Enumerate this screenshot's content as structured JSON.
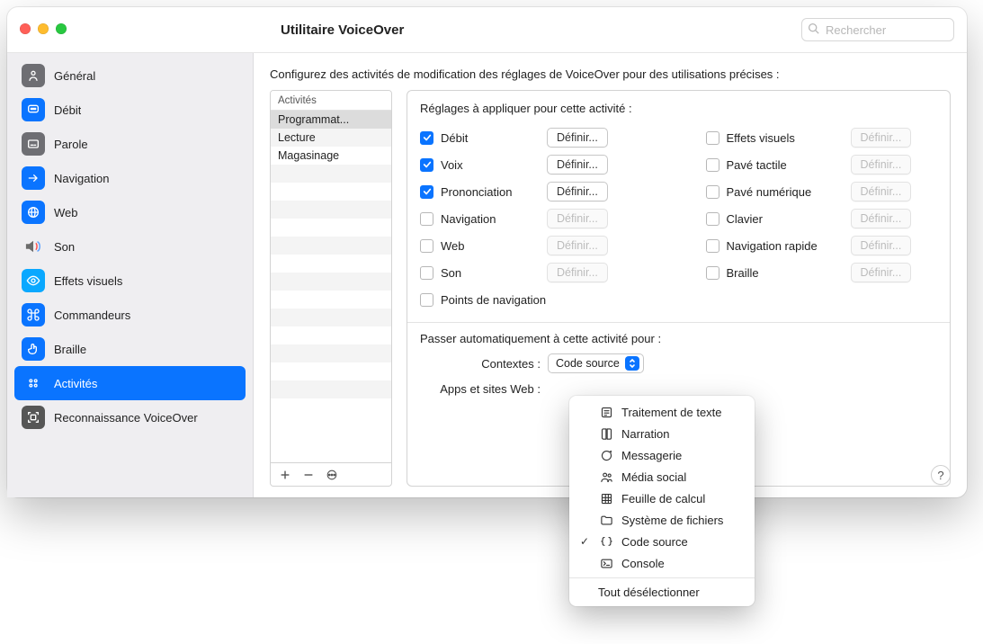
{
  "window": {
    "title": "Utilitaire VoiceOver",
    "search_placeholder": "Rechercher"
  },
  "sidebar": {
    "items": [
      {
        "label": "Général",
        "icon_name": "accessibility-icon",
        "icon_bg": "#6e6e73",
        "icon_glyph": "person"
      },
      {
        "label": "Débit",
        "icon_name": "speech-bubble-icon",
        "icon_bg": "#0a74ff",
        "icon_glyph": "bubble-dots"
      },
      {
        "label": "Parole",
        "icon_name": "caption-icon",
        "icon_bg": "#6e6e73",
        "icon_glyph": "caption"
      },
      {
        "label": "Navigation",
        "icon_name": "arrow-icon",
        "icon_bg": "#0a74ff",
        "icon_glyph": "arrow-right"
      },
      {
        "label": "Web",
        "icon_name": "globe-icon",
        "icon_bg": "#0a74ff",
        "icon_glyph": "globe"
      },
      {
        "label": "Son",
        "icon_name": "speaker-icon",
        "icon_bg": "transparent",
        "icon_glyph": "speaker"
      },
      {
        "label": "Effets visuels",
        "icon_name": "eye-icon",
        "icon_bg": "#0aa8ff",
        "icon_glyph": "eye"
      },
      {
        "label": "Commandeurs",
        "icon_name": "command-icon",
        "icon_bg": "#0a74ff",
        "icon_glyph": "command"
      },
      {
        "label": "Braille",
        "icon_name": "touch-icon",
        "icon_bg": "#0a74ff",
        "icon_glyph": "touch"
      },
      {
        "label": "Activités",
        "icon_name": "activities-icon",
        "icon_bg": "#0a74ff",
        "icon_glyph": "knobs",
        "selected": true
      },
      {
        "label": "Reconnaissance VoiceOver",
        "icon_name": "recognition-icon",
        "icon_bg": "#565656",
        "icon_glyph": "scan"
      }
    ]
  },
  "main": {
    "intro": "Configurez des activités de modification des réglages de VoiceOver pour des utilisations précises :",
    "activities_header": "Activités",
    "activities": [
      {
        "label": "Programmat...",
        "selected": true
      },
      {
        "label": "Lecture"
      },
      {
        "label": "Magasinage"
      }
    ],
    "footer": {
      "add_tooltip": "Ajouter",
      "remove_tooltip": "Supprimer",
      "more_tooltip": "Options"
    },
    "settings_title": "Réglages à appliquer pour cette activité :",
    "define_label": "Définir...",
    "left_options": [
      {
        "label": "Débit",
        "checked": true,
        "has_button": true
      },
      {
        "label": "Voix",
        "checked": true,
        "has_button": true
      },
      {
        "label": "Prononciation",
        "checked": true,
        "has_button": true
      },
      {
        "label": "Navigation",
        "checked": false,
        "has_button": true
      },
      {
        "label": "Web",
        "checked": false,
        "has_button": true
      },
      {
        "label": "Son",
        "checked": false,
        "has_button": true
      },
      {
        "label": "Points de navigation",
        "checked": false,
        "has_button": false
      }
    ],
    "right_options": [
      {
        "label": "Effets visuels",
        "checked": false,
        "has_button": true
      },
      {
        "label": "Pavé tactile",
        "checked": false,
        "has_button": true
      },
      {
        "label": "Pavé numérique",
        "checked": false,
        "has_button": true
      },
      {
        "label": "Clavier",
        "checked": false,
        "has_button": true
      },
      {
        "label": "Navigation rapide",
        "checked": false,
        "has_button": true
      },
      {
        "label": "Braille",
        "checked": false,
        "has_button": true
      }
    ],
    "auto_switch_title": "Passer automatiquement à cette activité pour :",
    "contexts_label": "Contextes :",
    "contexts_value": "Code source",
    "apps_label": "Apps et sites Web :",
    "help_label": "?"
  },
  "dropdown": {
    "items": [
      {
        "label": "Traitement de texte",
        "icon": "text",
        "checked": false
      },
      {
        "label": "Narration",
        "icon": "book",
        "checked": false
      },
      {
        "label": "Messagerie",
        "icon": "bubble",
        "checked": false
      },
      {
        "label": "Média social",
        "icon": "people",
        "checked": false
      },
      {
        "label": "Feuille de calcul",
        "icon": "grid",
        "checked": false
      },
      {
        "label": "Système de fichiers",
        "icon": "folder",
        "checked": false
      },
      {
        "label": "Code source",
        "icon": "braces",
        "checked": true
      },
      {
        "label": "Console",
        "icon": "terminal",
        "checked": false
      }
    ],
    "deselect_label": "Tout désélectionner"
  }
}
